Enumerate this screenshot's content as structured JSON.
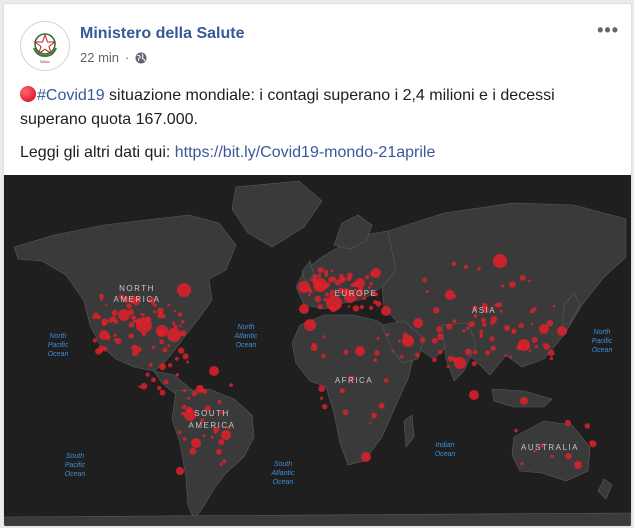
{
  "post": {
    "page_name": "Ministero della Salute",
    "time": "22 min",
    "separator": "·",
    "privacy_icon": "globe-icon",
    "more_label": "•••",
    "hashtag": "#Covid19",
    "text_after_hashtag": " situazione mondiale: i contagi superano i 2,4 milioni e i decessi superano quota 167.000.",
    "link_intro": "Leggi gli altri dati qui: ",
    "link_text": "https://bit.ly/Covid19-mondo-21aprile"
  },
  "map": {
    "colors": {
      "ocean": "#1f1f1f",
      "land": "#3a3a3a",
      "border": "#5a5a5a",
      "marker": "#e3202b",
      "ocean_label": "#3e8ed8",
      "continent_label": "#c7c7c7"
    },
    "continent_labels": {
      "north_america_1": "NORTH",
      "north_america_2": "AMERICA",
      "europe": "EUROPE",
      "asia": "ASIA",
      "africa": "AFRICA",
      "south_america_1": "SOUTH",
      "south_america_2": "AMERICA",
      "australia": "AUSTRALIA"
    },
    "ocean_labels": {
      "north_pacific_w": [
        "North",
        "Pacific",
        "Ocean"
      ],
      "north_atlantic": [
        "North",
        "Atlantic",
        "Ocean"
      ],
      "north_pacific_e": [
        "North",
        "Pacific",
        "Ocean"
      ],
      "south_pacific": [
        "South",
        "Pacific",
        "Ocean"
      ],
      "south_atlantic": [
        "South",
        "Atlantic",
        "Ocean"
      ],
      "indian": [
        "Indian",
        "Ocean"
      ]
    }
  }
}
